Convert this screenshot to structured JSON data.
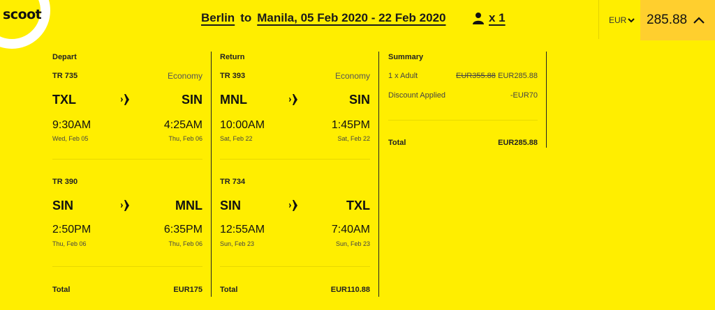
{
  "brand": {
    "name": "scoot"
  },
  "header": {
    "origin": "Berlin",
    "to_word": "to",
    "destination_dates": "Manila, 05 Feb 2020 - 22 Feb 2020",
    "passengers": "x 1",
    "currency": "EUR",
    "total_price": "285.88"
  },
  "depart": {
    "heading": "Depart",
    "legs": [
      {
        "flight": "TR 735",
        "cabin": "Economy",
        "from": "TXL",
        "to": "SIN",
        "dep_time": "9:30AM",
        "arr_time": "4:25AM",
        "dep_date": "Wed, Feb 05",
        "arr_date": "Thu, Feb 06"
      },
      {
        "flight": "TR 390",
        "cabin": "",
        "from": "SIN",
        "to": "MNL",
        "dep_time": "2:50PM",
        "arr_time": "6:35PM",
        "dep_date": "Thu, Feb 06",
        "arr_date": "Thu, Feb 06"
      }
    ],
    "total_label": "Total",
    "total": "EUR175"
  },
  "return": {
    "heading": "Return",
    "legs": [
      {
        "flight": "TR 393",
        "cabin": "Economy",
        "from": "MNL",
        "to": "SIN",
        "dep_time": "10:00AM",
        "arr_time": "1:45PM",
        "dep_date": "Sat, Feb 22",
        "arr_date": "Sat, Feb 22"
      },
      {
        "flight": "TR 734",
        "cabin": "",
        "from": "SIN",
        "to": "TXL",
        "dep_time": "12:55AM",
        "arr_time": "7:40AM",
        "dep_date": "Sun, Feb 23",
        "arr_date": "Sun, Feb 23"
      }
    ],
    "total_label": "Total",
    "total": "EUR110.88"
  },
  "summary": {
    "heading": "Summary",
    "adult_label": "1 x Adult",
    "old_price": "EUR355.88",
    "new_price": "EUR285.88",
    "discount_label": "Discount Applied",
    "discount_value": "-EUR70",
    "total_label": "Total",
    "total": "EUR285.88"
  },
  "icons": {
    "plane": "airplane-icon",
    "user": "user-icon",
    "chevron_down": "chevron-down-icon",
    "chevron_up": "chevron-up-icon"
  }
}
